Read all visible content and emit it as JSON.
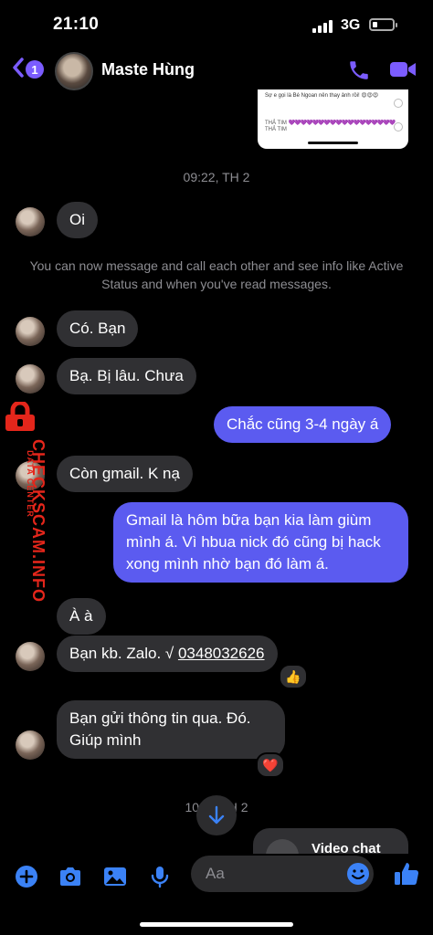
{
  "status_bar": {
    "time": "21:10",
    "network": "3G"
  },
  "header": {
    "back_badge": "1",
    "contact_name": "Maste Hùng"
  },
  "attachment_preview": {
    "line1": "Sợ e gọi là Bé Ngoan nên thay ảnh rồi! 😍😍😍",
    "line2_prefix": "THẢ TIM",
    "hearts": "💜💜💜💜💜💜💜💜💜💜💜💜💜💜💜💜💜💜",
    "line2_suffix": "THẢ TIM"
  },
  "chat": {
    "timestamp1": "09:22, TH 2",
    "system_message": "You can now message and call each other and see info like Active Status and when you've read messages.",
    "messages": [
      {
        "dir": "in",
        "text": "Oi"
      },
      {
        "dir": "in",
        "text": "Có. Bạn"
      },
      {
        "dir": "in",
        "text": "Bạ. Bị lâu. Chưa"
      },
      {
        "dir": "out",
        "text": "Chắc cũng 3-4 ngày á"
      },
      {
        "dir": "in",
        "text": "Còn gmail. K nạ"
      },
      {
        "dir": "out",
        "text": "Gmail là hôm bữa bạn kia làm giùm mình á. Vì hbua nick đó cũng bị hack xong mình nhờ bạn đó làm á."
      },
      {
        "dir": "in",
        "text": "À à"
      },
      {
        "dir": "in",
        "text_prefix": "Bạn kb. Zalo. √",
        "phone": "0348032626",
        "reaction": "👍"
      },
      {
        "dir": "in",
        "text": "Bạn gửi thông tin qua. Đó. Giúp mình",
        "reaction": "❤️"
      }
    ],
    "timestamp2": "10:__ TH 2",
    "video_chat_label": "Video chat"
  },
  "watermark": {
    "main": "CHECKSCAM.INFO",
    "sub": "DATA CENTER"
  },
  "composer": {
    "placeholder": "Aa"
  },
  "colors": {
    "accent": "#7b5cff",
    "outgoing_bubble": "#5b5bf0",
    "incoming_bubble": "#303033",
    "watermark": "#e4261b"
  }
}
